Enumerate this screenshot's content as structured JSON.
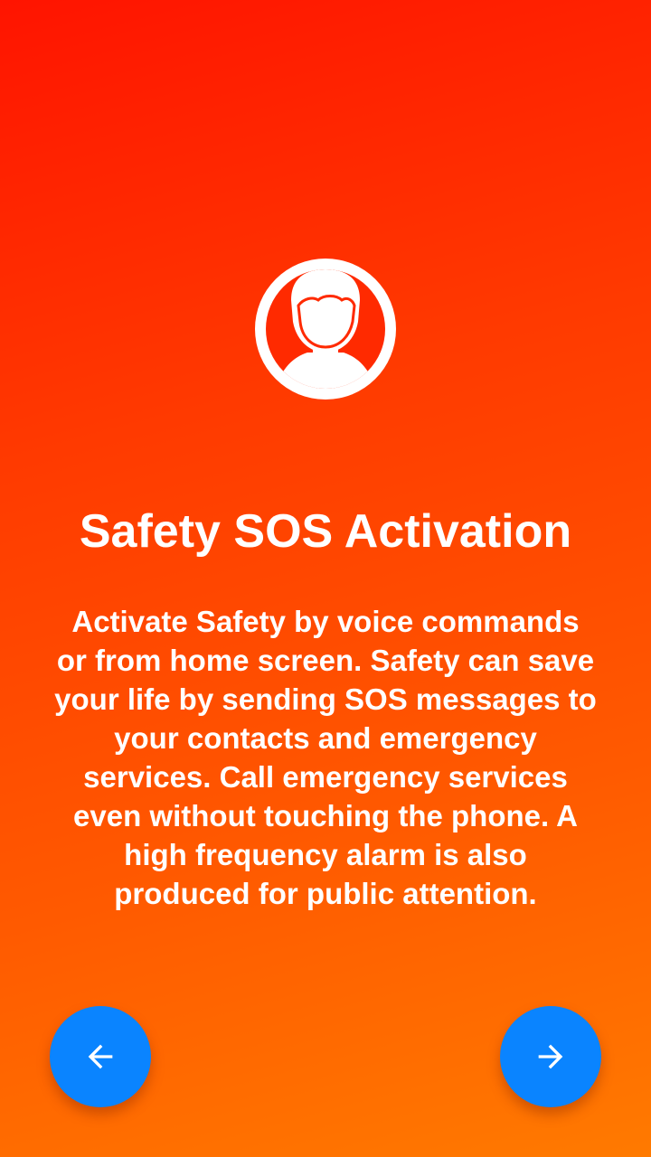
{
  "onboarding": {
    "title": "Safety SOS Activation",
    "description": "Activate Safety by voice commands or from home screen. Safety can save your life by sending SOS messages to your contacts and emergency services. Call emergency services even without touching the phone. A high frequency alarm is also produced for public attention.",
    "icon": "user-avatar-icon"
  },
  "navigation": {
    "prev_icon": "arrow-left-icon",
    "next_icon": "arrow-right-icon"
  },
  "colors": {
    "gradient_start": "#ff1400",
    "gradient_end": "#ff7a00",
    "fab_background": "#0a84ff",
    "text": "#ffffff"
  }
}
